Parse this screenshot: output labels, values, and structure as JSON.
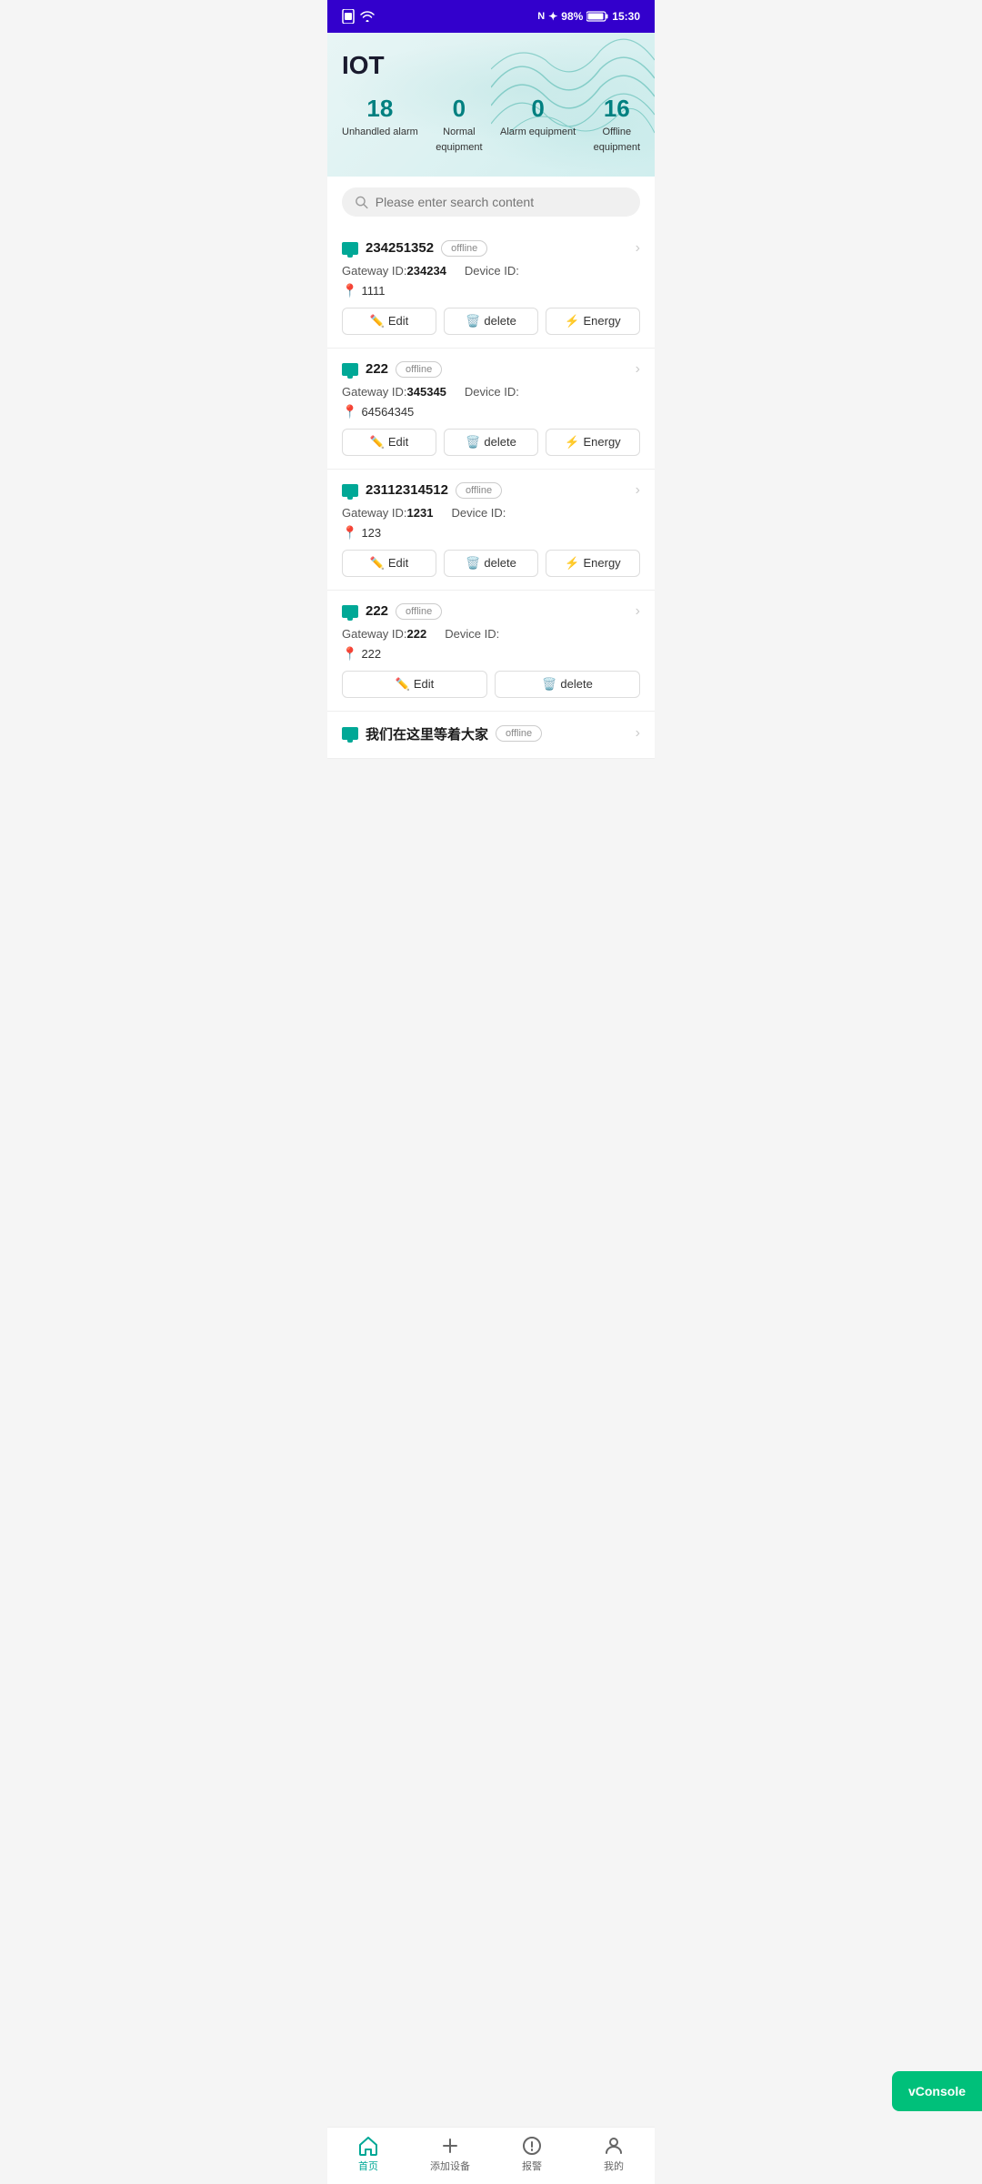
{
  "statusBar": {
    "battery": "98%",
    "time": "15:30"
  },
  "hero": {
    "title": "IOT",
    "stats": [
      {
        "number": "18",
        "label": "Unhandled alarm"
      },
      {
        "number": "0",
        "label": "Normal\nequipment"
      },
      {
        "number": "0",
        "label": "Alarm equipment"
      },
      {
        "number": "16",
        "label": "Offline\nequipment"
      }
    ]
  },
  "search": {
    "placeholder": "Please enter search content"
  },
  "devices": [
    {
      "name": "234251352",
      "status": "offline",
      "gatewayId": "234234",
      "deviceId": "",
      "location": "1111"
    },
    {
      "name": "222",
      "status": "offline",
      "gatewayId": "345345",
      "deviceId": "",
      "location": "64564345"
    },
    {
      "name": "23112314512",
      "status": "offline",
      "gatewayId": "1231",
      "deviceId": "",
      "location": "123"
    },
    {
      "name": "222",
      "status": "offline",
      "gatewayId": "222",
      "deviceId": "",
      "location": "222"
    },
    {
      "name": "我们在这里等着大家",
      "status": "offline",
      "gatewayId": "",
      "deviceId": "",
      "location": ""
    }
  ],
  "actions": {
    "edit": "Edit",
    "delete": "delete",
    "energy": "Energy"
  },
  "vconsole": "vConsole",
  "nav": [
    {
      "label": "首页",
      "icon": "home",
      "active": true
    },
    {
      "label": "添加设备",
      "icon": "plus",
      "active": false
    },
    {
      "label": "报警",
      "icon": "alert",
      "active": false
    },
    {
      "label": "我的",
      "icon": "user",
      "active": false
    }
  ]
}
